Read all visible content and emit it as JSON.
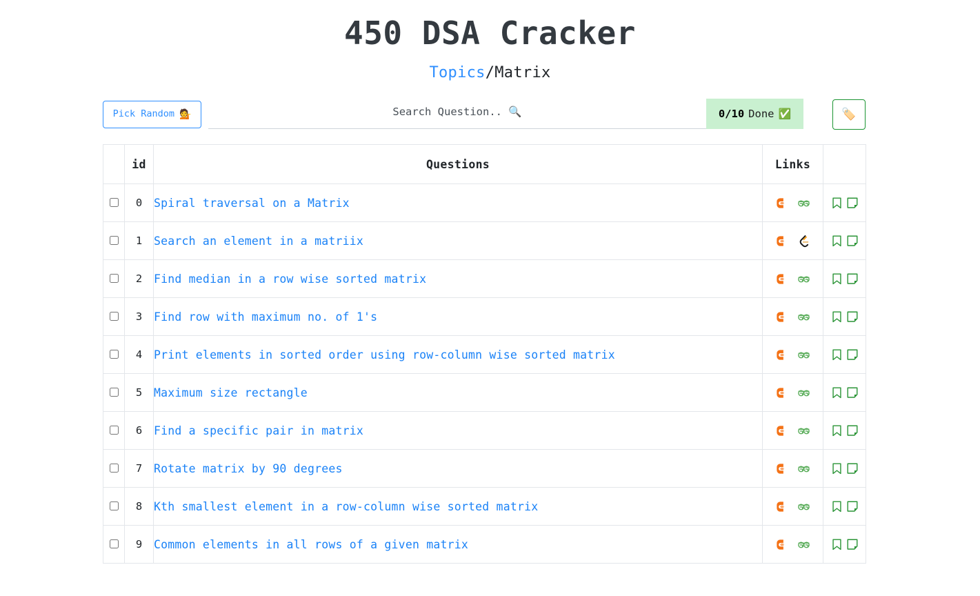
{
  "header": {
    "title": "450 DSA Cracker",
    "breadcrumb": {
      "parent": "Topics",
      "separator": "/",
      "current": "Matrix"
    }
  },
  "toolbar": {
    "pick_random_label": "Pick Random",
    "pick_random_emoji": "💁",
    "search_placeholder": "Search Question.. 🔍",
    "search_value": "",
    "progress": {
      "count": "0/10",
      "label": "Done",
      "emoji": "✅",
      "background_color": "#c9f0d0"
    },
    "tag_button_emoji": "🏷️",
    "tag_button_border_color": "#1a9431"
  },
  "table": {
    "columns": {
      "select": "",
      "id": "id",
      "questions": "Questions",
      "links": "Links",
      "actions": ""
    },
    "link_icon_names": [
      "codestudio-icon",
      "geeksforgeeks-icon",
      "leetcode-icon"
    ],
    "action_icon_names": [
      "bookmark-icon",
      "note-icon"
    ],
    "rows": [
      {
        "id": "0",
        "question": "Spiral traversal on a Matrix",
        "checked": false,
        "links": [
          "codestudio",
          "gfg"
        ]
      },
      {
        "id": "1",
        "question": "Search an element in a matriix",
        "checked": false,
        "links": [
          "codestudio",
          "leetcode"
        ]
      },
      {
        "id": "2",
        "question": "Find median in a row wise sorted matrix",
        "checked": false,
        "links": [
          "codestudio",
          "gfg"
        ]
      },
      {
        "id": "3",
        "question": "Find row with maximum no. of 1's",
        "checked": false,
        "links": [
          "codestudio",
          "gfg"
        ]
      },
      {
        "id": "4",
        "question": "Print elements in sorted order using row-column wise sorted matrix",
        "checked": false,
        "links": [
          "codestudio",
          "gfg"
        ]
      },
      {
        "id": "5",
        "question": "Maximum size rectangle",
        "checked": false,
        "links": [
          "codestudio",
          "gfg"
        ]
      },
      {
        "id": "6",
        "question": "Find a specific pair in matrix",
        "checked": false,
        "links": [
          "codestudio",
          "gfg"
        ]
      },
      {
        "id": "7",
        "question": "Rotate matrix by 90 degrees",
        "checked": false,
        "links": [
          "codestudio",
          "gfg"
        ]
      },
      {
        "id": "8",
        "question": "Kth smallest element in a row-column wise sorted matrix",
        "checked": false,
        "links": [
          "codestudio",
          "gfg"
        ]
      },
      {
        "id": "9",
        "question": "Common elements in all rows of a given matrix",
        "checked": false,
        "links": [
          "codestudio",
          "gfg"
        ]
      }
    ]
  },
  "colors": {
    "link_blue": "#1a82f7",
    "title_gray": "#343a40",
    "codestudio_orange": "#f47216",
    "gfg_green": "#5aad5a",
    "leetcode_dark": "#1a1a1a",
    "leetcode_yellow": "#ffa116",
    "action_green": "#2a9436",
    "border_gray": "#e3e6ea"
  }
}
